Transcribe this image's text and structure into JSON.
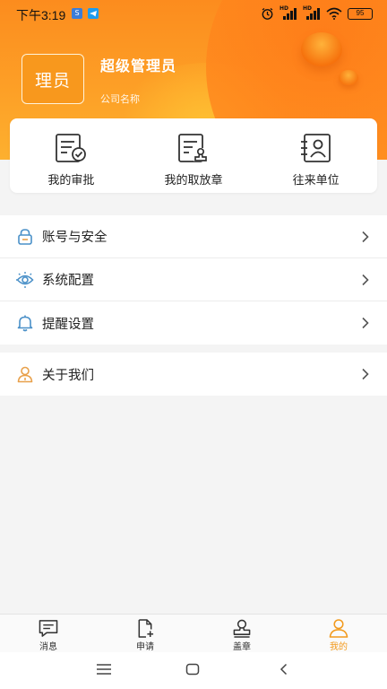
{
  "status_bar": {
    "time": "下午3:19",
    "app_badge_1": "S",
    "battery": "95",
    "signal_1": "HD",
    "signal_2": "HD"
  },
  "profile": {
    "avatar_text": "理员",
    "name": "超级管理员",
    "company": "公司名称"
  },
  "quick_actions": [
    {
      "label": "我的审批",
      "icon": "approval-doc-icon"
    },
    {
      "label": "我的取放章",
      "icon": "seal-doc-icon"
    },
    {
      "label": "往来单位",
      "icon": "contact-card-icon"
    }
  ],
  "settings": [
    {
      "label": "账号与安全",
      "icon": "lock-icon"
    },
    {
      "label": "系统配置",
      "icon": "eye-settings-icon"
    },
    {
      "label": "提醒设置",
      "icon": "bell-icon"
    }
  ],
  "about": {
    "label": "关于我们",
    "icon": "user-icon"
  },
  "tabbar": [
    {
      "label": "消息",
      "icon": "message-icon",
      "active": false
    },
    {
      "label": "申请",
      "icon": "new-doc-icon",
      "active": false
    },
    {
      "label": "盖章",
      "icon": "stamp-icon",
      "active": false
    },
    {
      "label": "我的",
      "icon": "profile-icon",
      "active": true
    }
  ],
  "colors": {
    "accent": "#f29a1d",
    "header_orange": "#fc8c1e",
    "icon_blue": "#4a90c8",
    "icon_orange": "#e8a04a"
  }
}
